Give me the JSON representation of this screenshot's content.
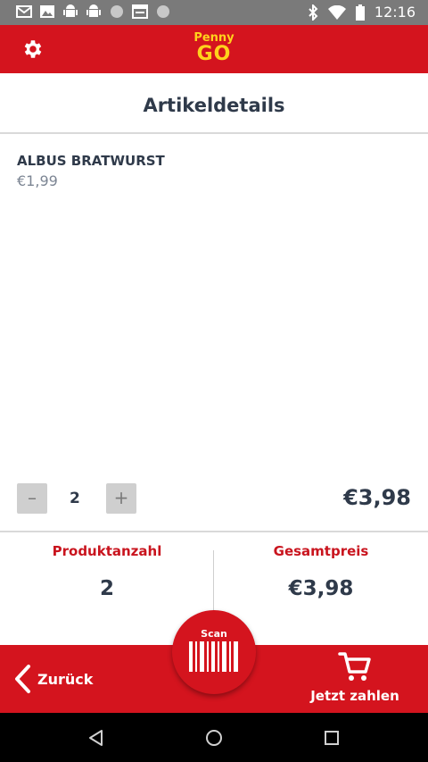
{
  "status_bar": {
    "time": "12:16",
    "left_icons": [
      "gmail-icon",
      "image-icon",
      "android-icon",
      "android-icon",
      "circle-icon",
      "calendar-icon",
      "circle-icon"
    ],
    "right_icons": [
      "bluetooth-icon",
      "wifi-icon",
      "battery-icon"
    ]
  },
  "app_bar": {
    "logo_top": "Penny",
    "logo_bottom": "GO",
    "settings_icon": "gear-icon"
  },
  "page": {
    "title": "Artikeldetails"
  },
  "product": {
    "name": "ALBUS BRATWURST",
    "unit_price": "€1,99",
    "quantity": "2",
    "line_total": "€3,98",
    "minus_label": "–",
    "plus_label": "+"
  },
  "summary": {
    "count_label": "Produktanzahl",
    "count_value": "2",
    "total_label": "Gesamtpreis",
    "total_value": "€3,98"
  },
  "bottom_bar": {
    "back_label": "Zurück",
    "scan_label": "Scan",
    "pay_label": "Jetzt zahlen"
  },
  "colors": {
    "brand_red": "#d4141e",
    "logo_yellow": "#ffd21c",
    "text_dark": "#2f3a4a",
    "text_muted": "#7c8593"
  }
}
